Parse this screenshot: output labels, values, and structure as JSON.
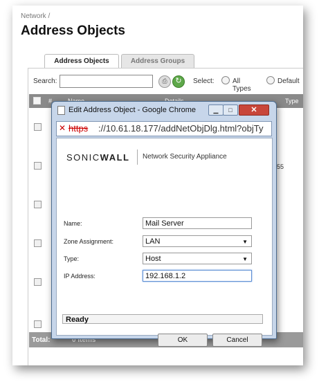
{
  "page": {
    "breadcrumb": "Network /",
    "title": "Address Objects",
    "tabs": [
      "Address Objects",
      "Address Groups"
    ],
    "search_label": "Search:",
    "select_label": "Select:",
    "radio_all": "All Types",
    "radio_default": "Default",
    "table_headers": {
      "hash": "#",
      "name": "Name",
      "details": "Details",
      "type": "Type"
    },
    "row_fragment": "55",
    "footer_total": "Total:",
    "footer_count": "0 Items"
  },
  "dialog": {
    "window_title": "Edit Address Object - Google Chrome",
    "url_protocol": "https",
    "url_rest": "://10.61.18.177/addNetObjDlg.html?objTy",
    "brand_left": "SONIC",
    "brand_right": "WALL",
    "product": "Network Security Appliance",
    "fields": [
      {
        "label": "Name:",
        "value": "Mail Server"
      },
      {
        "label": "Zone Assignment:",
        "value": "LAN"
      },
      {
        "label": "Type:",
        "value": "Host"
      },
      {
        "label": "IP Address:",
        "value": "192.168.1.2"
      }
    ],
    "status": "Ready",
    "ok_label": "OK",
    "cancel_label": "Cancel"
  }
}
